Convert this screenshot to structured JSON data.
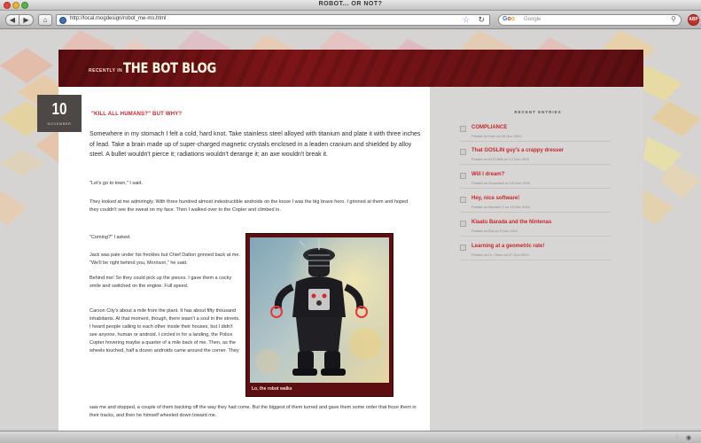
{
  "window": {
    "title": "ROBOT... OR NOT?"
  },
  "toolbar": {
    "back_label": "◀",
    "forward_label": "▶",
    "home_label": "⌂",
    "url": "http://local.mogdesign/robot_me-ms.html",
    "search_placeholder": "Google",
    "search_engine": "Google",
    "reload_symbol": "↻",
    "star_symbol": "☆",
    "search_symbol": "⚲",
    "addon_label": "ABP"
  },
  "blog": {
    "header_pre": "RECENTLY IN",
    "header_title": "THE BOT BLOG",
    "date_day": "10",
    "date_month": "NOVEMBER"
  },
  "post": {
    "title": "\"KILL ALL HUMANS?\" BUT WHY?",
    "lead": "Somewhere in my stomach I felt a cold, hard knot. Take stainless steel alloyed with titanium and plate it with three inches of lead. Take a brain made up of super-charged magnetic crystals enclosed in a leaden cranium and shielded by alloy steel. A bullet wouldn't pierce it; radiations wouldn't derange it; an axe wouldn't break it.",
    "p1": "\"Let's go to town,\" I said.",
    "p2": "They looked at me admiringly. With three hundred almost indestructible androids on the loose I was the big brave hero. I grinned at them and hoped they couldn't see the sweat on my face. Then I walked over to the Copter and climbed in.",
    "p3": "\"Coming?\" I asked.",
    "p4": "Jack was pale under his freckles but Chief Dalton grinned back at me. \"We'll be right behind you, Morrison,\" he said.",
    "p5": "Behind me! So they could pick up the pieces. I gave them a cocky smile and switched on the engine. Full speed.",
    "p6": "Carson City's about a mile from the plant. It has about fifty thousand inhabitants. At that moment, though, there wasn't a soul in the streets. I heard people calling to each other inside their houses, but I didn't see anyone, human or android. I circled in for a landing, the Police Copter hovering maybe a quarter of a mile back of me. Then, as the wheels touched, half a dozen androids came around the corner. They",
    "p7": "saw me and stopped, a couple of them backing off the way they had come. But the biggest of them turned and gave them some order that froze them in their tracks, and then he himself wheeled down toward me.",
    "photo_caption": "Lo, the robot walks"
  },
  "sidebar": {
    "heading": "RECENT ENTRIES",
    "items": [
      {
        "title": "COMPLIANCE",
        "meta": "Posted on Inter on 28 Dec 2010"
      },
      {
        "title": "That GOSLIN guy's a crappy dresser",
        "meta": "Posted on AUTUMN on 12 Dec 2010"
      },
      {
        "title": "Will I dream?",
        "meta": "Posted on Grounded on 16 Dec 2010"
      },
      {
        "title": "Hey, nice software!",
        "meta": "Posted on Number 2 on 15 Dec 2010"
      },
      {
        "title": "Klaatu Barada and the Nintenas",
        "meta": "Posted on Bot on 9 Dec 2010"
      },
      {
        "title": "Learning at a geometric rate!",
        "meta": "Posted on Dr. Otron on 27 Nov 2010"
      }
    ]
  },
  "colors": {
    "accent_red": "#c8262a",
    "header_maroon": "#6e1215",
    "badge_dark": "#4d4845"
  }
}
